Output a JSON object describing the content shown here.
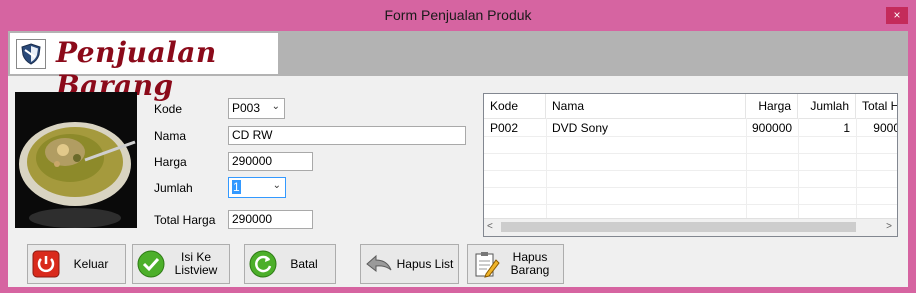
{
  "window": {
    "title": "Form Penjualan Produk",
    "close_label": "×"
  },
  "header": {
    "title": "Penjualan Barang"
  },
  "form": {
    "kode_label": "Kode",
    "kode_value": "P003",
    "nama_label": "Nama",
    "nama_value": "CD RW",
    "harga_label": "Harga",
    "harga_value": "290000",
    "jumlah_label": "Jumlah",
    "jumlah_value": "1",
    "total_label": "Total Harga",
    "total_value": "290000"
  },
  "listview": {
    "columns": [
      "Kode",
      "Nama",
      "Harga",
      "Jumlah",
      "Total H"
    ],
    "rows": [
      {
        "kode": "P002",
        "nama": "DVD Sony",
        "harga": "900000",
        "jumlah": "1",
        "total": "9000"
      }
    ]
  },
  "buttons": {
    "keluar": "Keluar",
    "isi_line1": "Isi Ke",
    "isi_line2": "Listview",
    "batal": "Batal",
    "hapus_list": "Hapus List",
    "hapus_barang_line1": "Hapus",
    "hapus_barang_line2": "Barang"
  },
  "colors": {
    "window_frame": "#d664a1",
    "close_button": "#c42b5b",
    "header_text": "#8b0a1a",
    "header_band": "#b3b3b3"
  },
  "icons": {
    "logo": "shield-logo-icon",
    "keluar": "power-icon",
    "isi": "check-icon",
    "batal": "refresh-icon",
    "hapus_list": "undo-arrow-icon",
    "hapus_barang": "clipboard-pencil-icon"
  }
}
